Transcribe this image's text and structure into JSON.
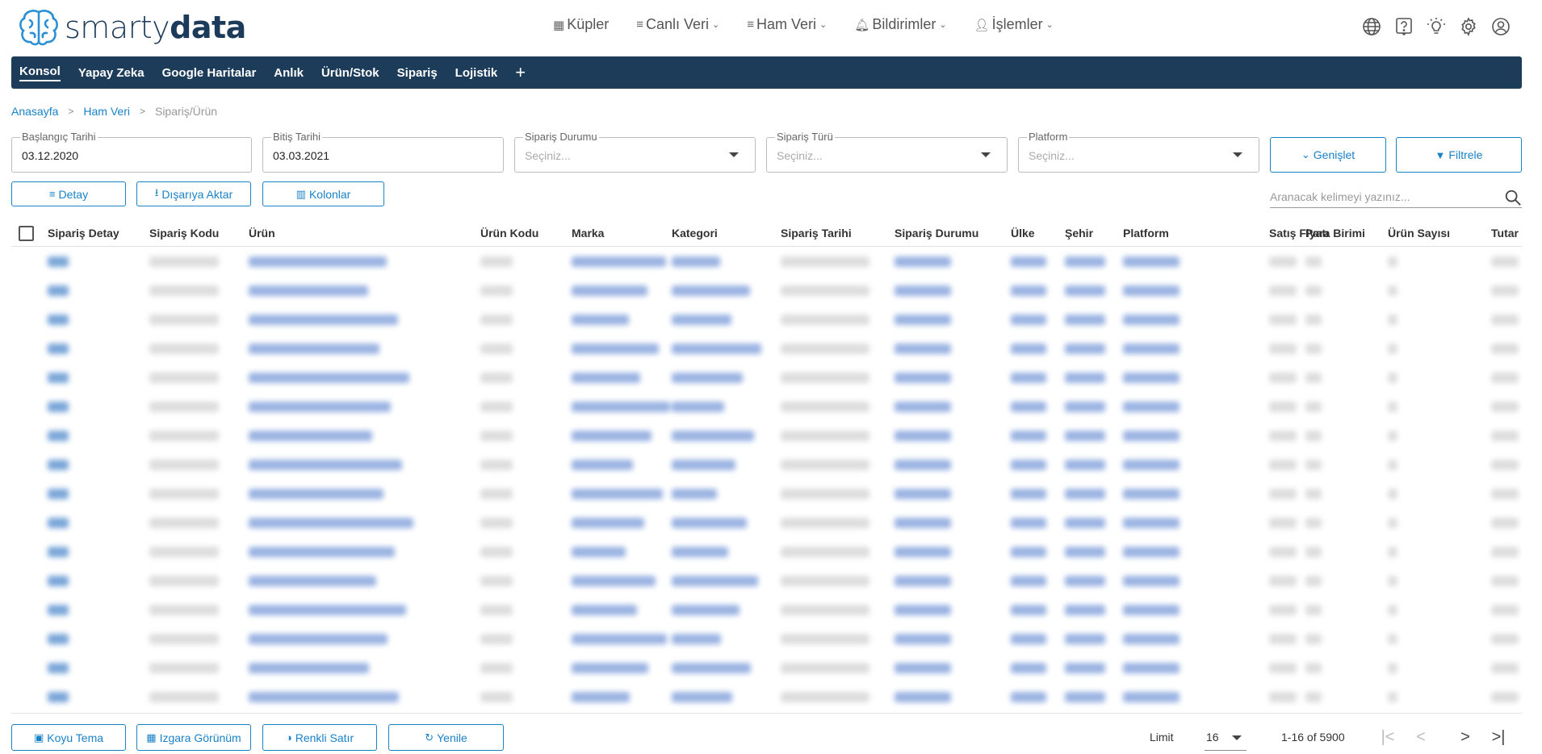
{
  "brand": {
    "logo_text_light": "smarty",
    "logo_text_bold": "data"
  },
  "nav": {
    "items": [
      {
        "label": "Küpler",
        "icon": "grid-icon"
      },
      {
        "label": "Canlı Veri",
        "icon": "list-icon"
      },
      {
        "label": "Ham Veri",
        "icon": "list-icon"
      },
      {
        "label": "Bildirimler",
        "icon": "bell-icon"
      },
      {
        "label": "İşlemler",
        "icon": "user-gear-icon"
      }
    ]
  },
  "tabs": [
    "Konsol",
    "Yapay Zeka",
    "Google Haritalar",
    "Anlık",
    "Ürün/Stok",
    "Sipariş",
    "Lojistik"
  ],
  "breadcrumb": [
    "Anasayfa",
    "Ham Veri",
    "Sipariş/Ürün"
  ],
  "filters": {
    "start_date": {
      "label": "Başlangıç Tarihi",
      "value": "03.12.2020"
    },
    "end_date": {
      "label": "Bitiş Tarihi",
      "value": "03.03.2021"
    },
    "order_status": {
      "label": "Sipariş Durumu",
      "placeholder": "Seçiniz..."
    },
    "order_type": {
      "label": "Sipariş Türü",
      "placeholder": "Seçiniz..."
    },
    "platform": {
      "label": "Platform",
      "placeholder": "Seçiniz..."
    },
    "expand_label": "Genişlet",
    "filter_label": "Filtrele"
  },
  "actions": {
    "detail": "Detay",
    "export": "Dışarıya Aktar",
    "columns": "Kolonlar"
  },
  "search": {
    "placeholder": "Aranacak kelimeyi yazınız..."
  },
  "table": {
    "headers": [
      "Sipariş Detay",
      "Sipariş Kodu",
      "Ürün",
      "Ürün Kodu",
      "Marka",
      "Kategori",
      "Sipariş Tarihi",
      "Sipariş Durumu",
      "Ülke",
      "Şehir",
      "Platform",
      "Satış Fiyatı",
      "Para Birimi",
      "Ürün Sayısı",
      "Tutar"
    ],
    "row_count_visible": 16
  },
  "footer": {
    "dark_theme": "Koyu Tema",
    "grid_view": "Izgara Görünüm",
    "colored_rows": "Renkli Satır",
    "refresh": "Yenile",
    "limit_label": "Limit",
    "limit_value": "16",
    "range": "1-16 of 5900"
  },
  "colors": {
    "accent": "#1a82c7",
    "tabbar": "#1c3c5a",
    "brand": "#1c3b5a"
  }
}
